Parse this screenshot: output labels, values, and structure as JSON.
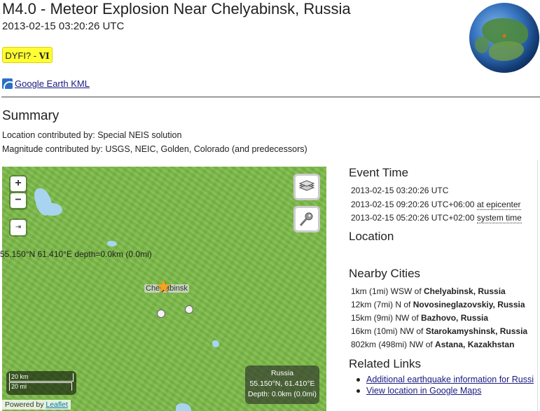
{
  "header": {
    "title": "M4.0 - Meteor Explosion Near Chelyabinsk, Russia",
    "time": "2013-02-15 03:20:26 UTC",
    "dyfi_prefix": "DYFI? -",
    "dyfi_intensity": "VI",
    "kml_link": "Google Earth KML"
  },
  "summary": {
    "heading": "Summary",
    "location_contributed": "Location contributed by: Special NEIS solution",
    "magnitude_contributed": "Magnitude contributed by: USGS, NEIC, Golden, Colorado (and predecessors)"
  },
  "map": {
    "zoom_in": "+",
    "zoom_out": "−",
    "city_label": "Chelyabinsk",
    "scale_km": "20 km",
    "scale_mi": "20 mi",
    "info_country": "Russia",
    "info_coords": "55.150°N, 61.410°E",
    "info_depth": "Depth: 0.0km (0.0mi)",
    "attribution_prefix": "Powered by",
    "attribution_link": "Leaflet",
    "land_color": "#7dbb49",
    "water_color": "#a8d4f0",
    "epicenter_color": "#f5a41c"
  },
  "event_time": {
    "heading": "Event Time",
    "utc": "2013-02-15 03:20:26 UTC",
    "epicenter_time": "2013-02-15 09:20:26 UTC+06:00",
    "epicenter_label": "at epicenter",
    "system_time": "2013-02-15 05:20:26 UTC+02:00",
    "system_label": "system time"
  },
  "location": {
    "heading": "Location",
    "value": "55.150°N 61.410°E depth=0.0km (0.0mi)"
  },
  "nearby": {
    "heading": "Nearby Cities",
    "cities": [
      {
        "dist": "1km (1mi) WSW of",
        "name": "Chelyabinsk, Russia"
      },
      {
        "dist": "12km (7mi) N of",
        "name": "Novosineglazovskiy, Russia"
      },
      {
        "dist": "15km (9mi) NW of",
        "name": "Bazhovo, Russia"
      },
      {
        "dist": "16km (10mi) NW of",
        "name": "Starokamyshinsk, Russia"
      },
      {
        "dist": "802km (498mi) NW of",
        "name": "Astana, Kazakhstan"
      }
    ]
  },
  "related": {
    "heading": "Related Links",
    "links": [
      "Additional earthquake information for Russi",
      "View location in Google Maps"
    ]
  }
}
